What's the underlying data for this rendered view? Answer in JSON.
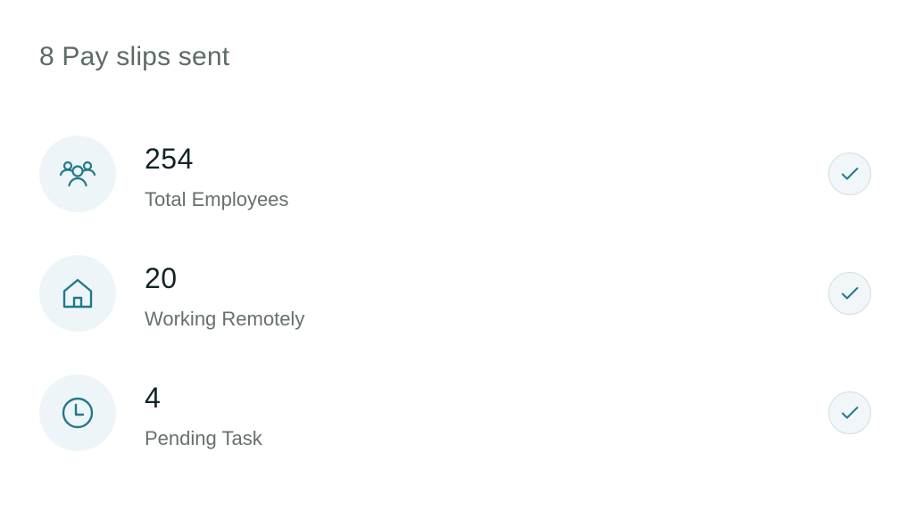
{
  "header": {
    "title": "8 Pay slips sent"
  },
  "stats": [
    {
      "icon": "people-icon",
      "value": "254",
      "label": "Total Employees"
    },
    {
      "icon": "home-icon",
      "value": "20",
      "label": "Working Remotely"
    },
    {
      "icon": "clock-icon",
      "value": "4",
      "label": "Pending Task"
    }
  ],
  "colors": {
    "accent": "#1f7a8c",
    "icon_bg": "#eef5f8",
    "heading": "#5d6b68",
    "value": "#112326",
    "label": "#66706e"
  }
}
